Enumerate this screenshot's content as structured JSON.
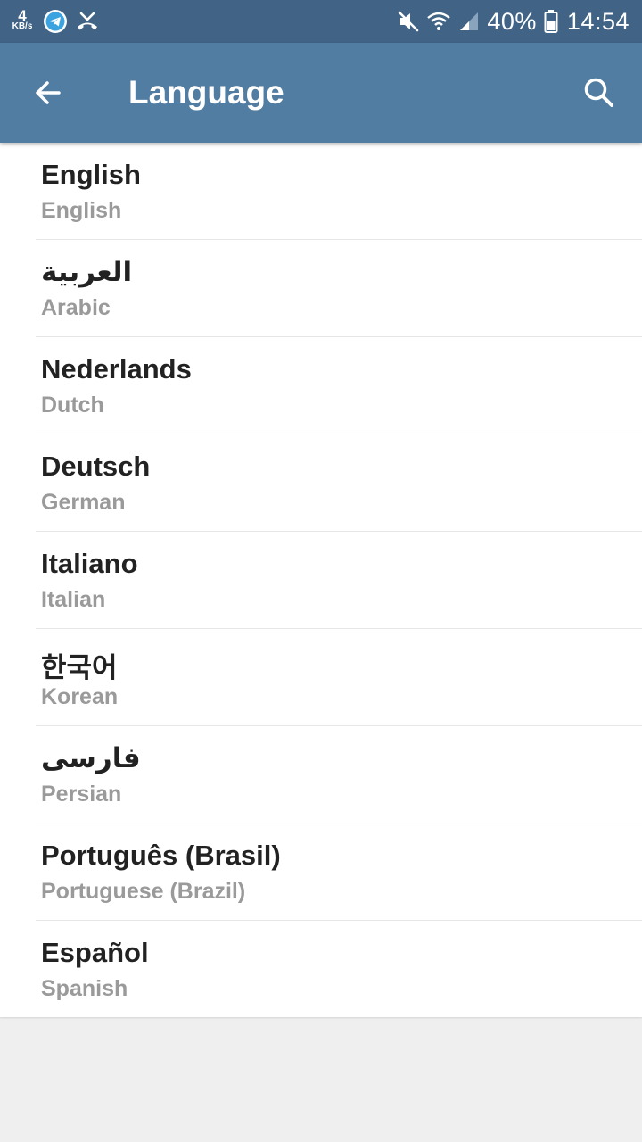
{
  "status_bar": {
    "net_speed_value": "4",
    "net_speed_unit": "KB/s",
    "battery_percent": "40%",
    "time": "14:54",
    "icons": [
      "telegram-icon",
      "missed-call-icon",
      "mute-icon",
      "wifi-icon",
      "signal-icon",
      "battery-icon"
    ]
  },
  "app_bar": {
    "title": "Language",
    "back_icon": "arrow-back-icon",
    "search_icon": "search-icon",
    "background": "#517da2"
  },
  "languages": [
    {
      "name": "English",
      "english": "English"
    },
    {
      "name": "العربية",
      "english": "Arabic"
    },
    {
      "name": "Nederlands",
      "english": "Dutch"
    },
    {
      "name": "Deutsch",
      "english": "German"
    },
    {
      "name": "Italiano",
      "english": "Italian"
    },
    {
      "name": "한국어",
      "english": "Korean"
    },
    {
      "name": "فارسی",
      "english": "Persian"
    },
    {
      "name": "Português (Brasil)",
      "english": "Portuguese (Brazil)"
    },
    {
      "name": "Español",
      "english": "Spanish"
    }
  ],
  "colors": {
    "status_bar": "#416486",
    "primary_text": "#222222",
    "secondary_text": "#9a9a9a",
    "background": "#efefef"
  }
}
